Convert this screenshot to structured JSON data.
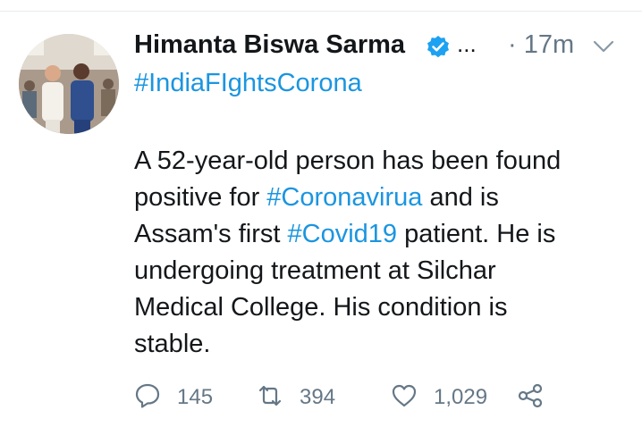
{
  "tweet": {
    "author_name": "Himanta Biswa Sarma",
    "verified_icon": "verified-badge-icon",
    "ellipsis": "...",
    "time": "· 17m",
    "caret_icon": "chevron-down-icon",
    "hashtag_line": "#IndiaFIghtsCorona",
    "body": {
      "l1": "A 52-year-old person has been found",
      "l2_pre": "positive for ",
      "l2_tag": "#Coronavirua",
      "l2_post": " and is",
      "l3_pre": "Assam's first ",
      "l3_tag": "#Covid19",
      "l3_post": " patient. He is",
      "l4": "undergoing treatment at Silchar",
      "l5": "Medical College. His condition is",
      "l6": "stable."
    }
  },
  "actions": {
    "reply_count": "145",
    "retweet_count": "394",
    "like_count": "1,029",
    "icons": [
      "reply-icon",
      "retweet-icon",
      "like-icon",
      "share-icon"
    ]
  },
  "colors": {
    "link": "#1b95e0",
    "muted": "#657786",
    "text": "#14171a",
    "verified": "#1da1f2"
  }
}
